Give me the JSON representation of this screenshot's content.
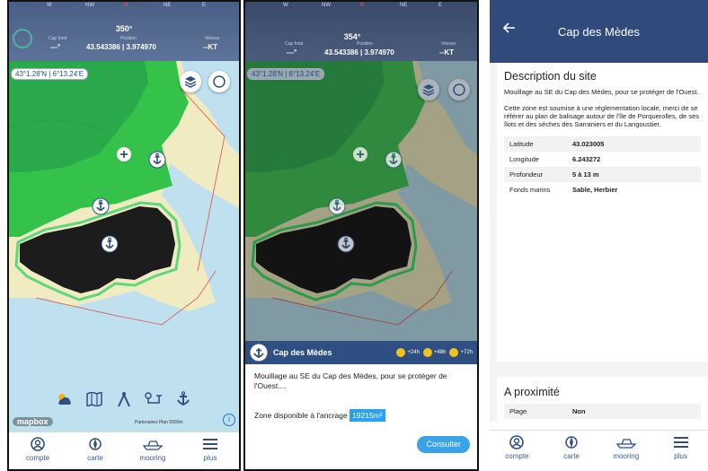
{
  "screens": {
    "map": {
      "compass": {
        "marks": [
          "W",
          "NW",
          "N",
          "NE",
          "E"
        ],
        "heading": "350°"
      },
      "cap_label": "Cap fond",
      "cap_value": "---°",
      "position_label": "Position",
      "position_value": "43.543386 | 3.974970",
      "speed_label": "Vitesse",
      "speed_value": "--KT",
      "coordinate_chip": "43°1.28'N | 6°13.24'E",
      "mapbox": "mapbox",
      "attribution": "Partenaires  Plan  5000m",
      "info": "i"
    },
    "detail_map": {
      "compass": {
        "marks": [
          "W",
          "NW",
          "N",
          "NE",
          "E"
        ],
        "heading": "354°"
      },
      "cap_label": "Cap fond",
      "cap_value": "---°",
      "position_label": "Position",
      "position_value": "43.543386 | 3.974970",
      "speed_label": "Vitesse",
      "speed_value": "--KT",
      "coordinate_chip": "43°1.28'N | 6°13.24'E",
      "sheet": {
        "title": "Cap des Mèdes",
        "forecast": [
          "+24h",
          "+48h",
          "+72h"
        ],
        "description": "Mouillage au SE du Cap des Mèdes, pour se protéger de l'Ouest....",
        "zone_label": "Zone disponible à l'ancrage",
        "zone_value": "19215m²",
        "button": "Consulter"
      }
    },
    "site": {
      "title": "Cap des Mèdes",
      "section_title": "Description du site",
      "paragraph1": "Mouillage au SE du Cap des Mèdes, pour se protéger de l'Ouest.",
      "paragraph2": "Cette zone est soumise à une réglementation locale, merci de se référer au plan de balisage autour de l'île de Porquerolles, de ses îlots et des sèches des Sarraniers et du Langoustier.",
      "facts": [
        {
          "label": "Latitude",
          "value": "43.023005"
        },
        {
          "label": "Longitude",
          "value": "6.243272"
        },
        {
          "label": "Profondeur",
          "value": "5 à 13 m"
        },
        {
          "label": "Fonds marins",
          "value": "Sable, Herbier"
        }
      ],
      "nearby_title": "A proximité",
      "nearby": [
        {
          "label": "Plage",
          "value": "Non"
        }
      ]
    }
  },
  "tabbar": [
    {
      "label": "compte",
      "icon": "user-icon"
    },
    {
      "label": "carte",
      "icon": "compass-icon"
    },
    {
      "label": "mooring",
      "icon": "boat-icon"
    },
    {
      "label": "plus",
      "icon": "menu-icon"
    }
  ],
  "colors": {
    "header": "#2f4a7b",
    "accent": "#3aa2e6",
    "land": "#34c24a",
    "sea": "#bfe1ef",
    "island": "#1c1c1c"
  }
}
